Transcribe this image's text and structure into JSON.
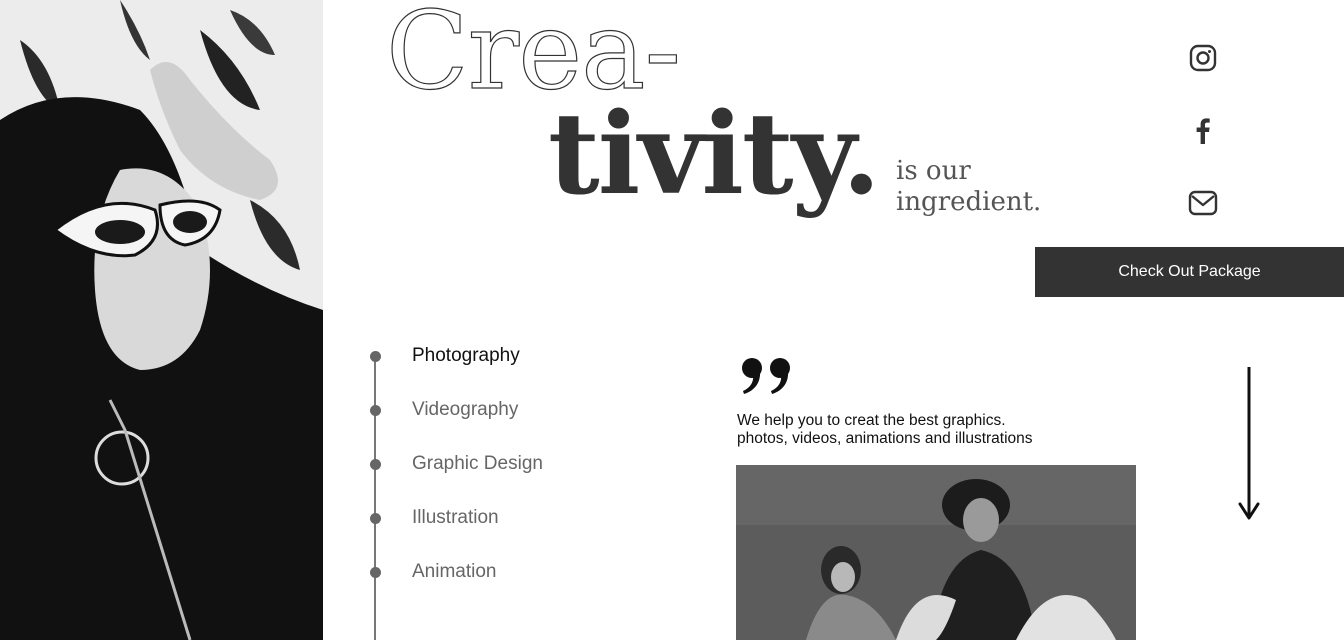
{
  "headline": {
    "line1": "Crea-",
    "line2": "tivity.",
    "tagline_line1": "is our",
    "tagline_line2": "ingredient."
  },
  "social": {
    "icons": [
      "instagram-icon",
      "facebook-icon",
      "mail-icon"
    ]
  },
  "cta": {
    "label": "Check Out Package"
  },
  "services": {
    "items": [
      {
        "label": "Photography",
        "active": true
      },
      {
        "label": "Videography",
        "active": false
      },
      {
        "label": "Graphic Design",
        "active": false
      },
      {
        "label": "Illustration",
        "active": false
      },
      {
        "label": "Animation",
        "active": false
      }
    ]
  },
  "quote": {
    "icon": "quote-icon",
    "line1": "We help you to creat the best graphics.",
    "line2": "photos, videos, animations and illustrations"
  },
  "colors": {
    "dark": "#333333",
    "text_muted": "#666666",
    "background": "#ffffff"
  }
}
